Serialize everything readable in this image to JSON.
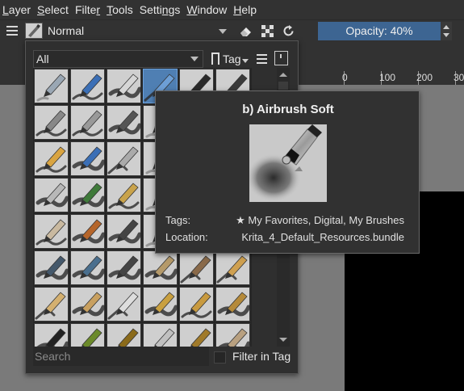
{
  "menubar": {
    "items": [
      {
        "label": "Layer",
        "u": "L"
      },
      {
        "label": "Select",
        "u": "S"
      },
      {
        "label": "Filter",
        "u": "F"
      },
      {
        "label": "Tools",
        "u": "T"
      },
      {
        "label": "Settings",
        "u": "n"
      },
      {
        "label": "Window",
        "u": "W"
      },
      {
        "label": "Help",
        "u": "H"
      }
    ]
  },
  "toolbar": {
    "blend_mode": "Normal",
    "opacity_label": "Opacity: 40%",
    "opacity_fraction": 0.4
  },
  "ruler": {
    "labels": [
      "0",
      "100",
      "200",
      "30"
    ]
  },
  "chooser": {
    "tag_filter": "All",
    "tag_button": "Tag",
    "search_placeholder": "Search",
    "filter_in_tag": "Filter in Tag"
  },
  "tooltip": {
    "title": "b) Airbrush Soft",
    "tags_label": "Tags:",
    "tags_star": "★",
    "tags_value": "My Favorites, Digital, My Brushes",
    "location_label": "Location:",
    "location_value": "Krita_4_Default_Resources.bundle"
  }
}
